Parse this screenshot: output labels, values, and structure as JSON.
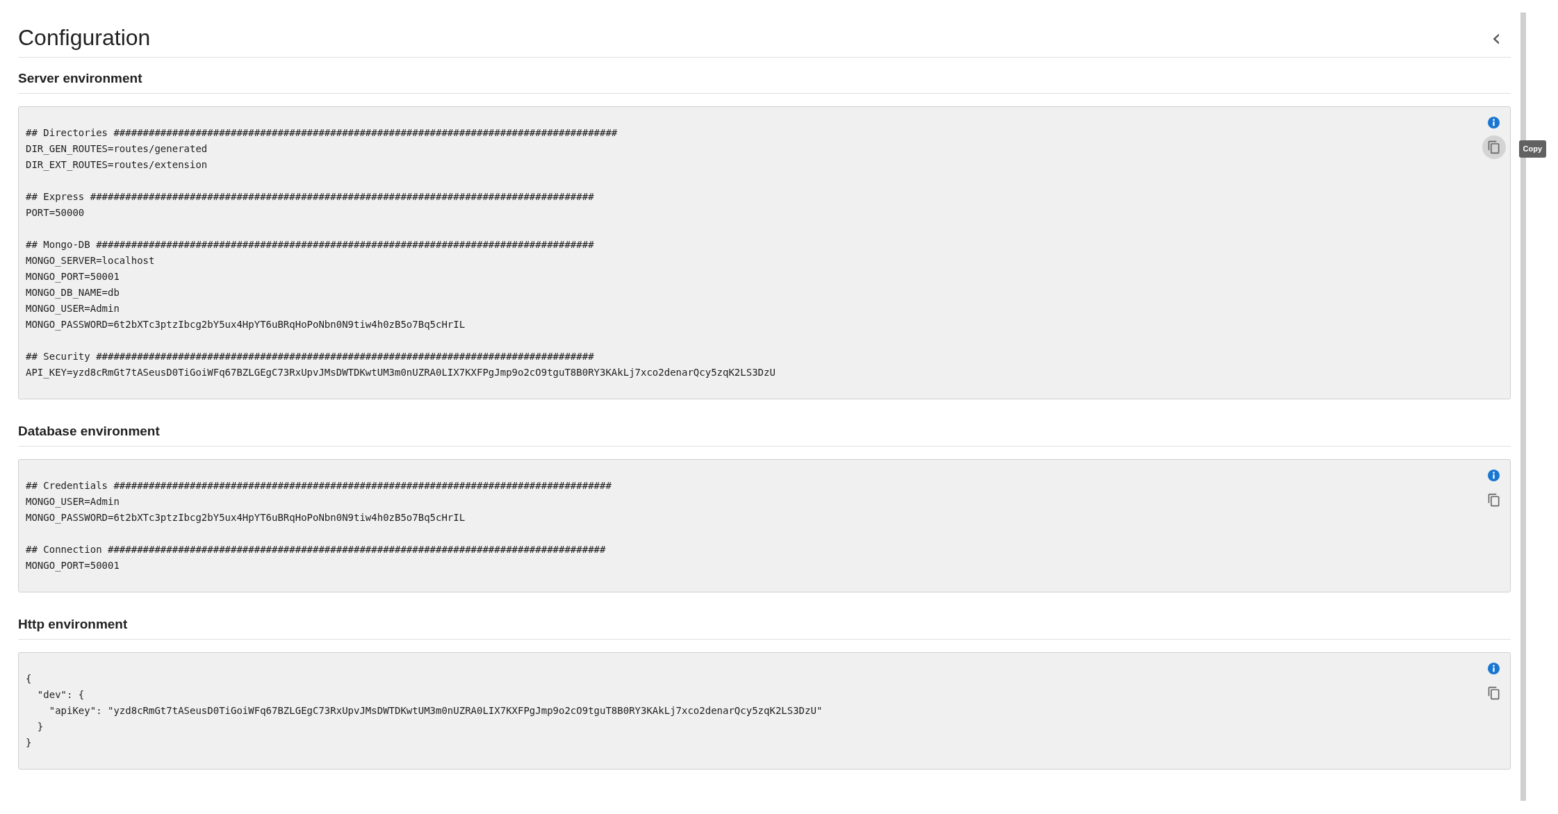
{
  "page": {
    "title": "Configuration",
    "collapse_icon": "‹"
  },
  "sections": [
    {
      "title": "Server environment",
      "copy_hovered": true,
      "tooltip": "Copy",
      "groups": [
        [
          "## Directories ######################################################################################",
          "DIR_GEN_ROUTES=routes/generated",
          "DIR_EXT_ROUTES=routes/extension"
        ],
        [
          "## Express ######################################################################################",
          "PORT=50000"
        ],
        [
          "## Mongo-DB #####################################################################################",
          "MONGO_SERVER=localhost",
          "MONGO_PORT=50001",
          "MONGO_DB_NAME=db",
          "MONGO_USER=Admin",
          "MONGO_PASSWORD=6t2bXTc3ptzIbcg2bY5ux4HpYT6uBRqHoPoNbn0N9tiw4h0zB5o7Bq5cHrIL"
        ],
        [
          "## Security #####################################################################################",
          "API_KEY=yzd8cRmGt7tASeusD0TiGoiWFq67BZLGEgC73RxUpvJMsDWTDKwtUM3m0nUZRA0LIX7KXFPgJmp9o2cO9tguT8B0RY3KAkLj7xco2denarQcy5zqK2LS3DzU"
        ]
      ]
    },
    {
      "title": "Database environment",
      "copy_hovered": false,
      "groups": [
        [
          "## Credentials #####################################################################################",
          "MONGO_USER=Admin",
          "MONGO_PASSWORD=6t2bXTc3ptzIbcg2bY5ux4HpYT6uBRqHoPoNbn0N9tiw4h0zB5o7Bq5cHrIL"
        ],
        [
          "## Connection #####################################################################################",
          "MONGO_PORT=50001"
        ]
      ]
    },
    {
      "title": "Http environment",
      "copy_hovered": false,
      "groups": [
        [
          "{",
          "  \"dev\": {",
          "    \"apiKey\": \"yzd8cRmGt7tASeusD0TiGoiWFq67BZLGEgC73RxUpvJMsDWTDKwtUM3m0nUZRA0LIX7KXFPgJmp9o2cO9tguT8B0RY3KAkLj7xco2denarQcy5zqK2LS3DzU\"",
          "  }",
          "}"
        ]
      ]
    }
  ]
}
